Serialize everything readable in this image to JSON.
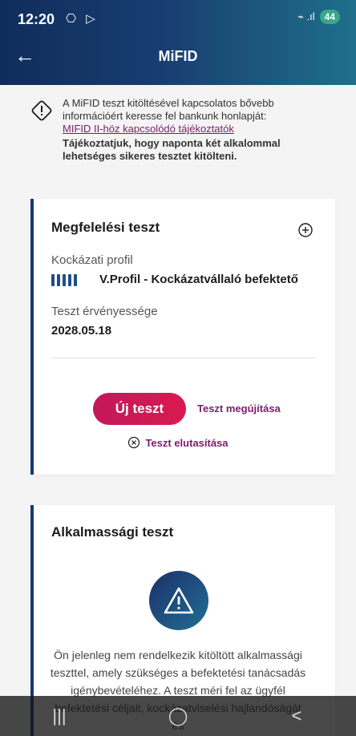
{
  "status_bar": {
    "time": "12:20",
    "icons_left": "⎔ ▷",
    "network": "⌁ .ıl",
    "battery": "44"
  },
  "header": {
    "title": "MiFID"
  },
  "info": {
    "line1": "A MiFID teszt kitöltésével kapcsolatos bővebb információért keresse fel bankunk honlapját:",
    "link": "MIFID II-höz kapcsolódó tájékoztatók",
    "notice": "Tájékoztatjuk, hogy naponta két alkalommal lehetséges sikeres tesztet kitölteni."
  },
  "compliance_card": {
    "title": "Megfelelési teszt",
    "risk_label": "Kockázati profil",
    "risk_value": "V.Profil - Kockázatvállaló befektető",
    "risk_level": 5,
    "validity_label": "Teszt érvényessége",
    "validity_value": "2028.05.18",
    "new_test_button": "Új teszt",
    "renew_link": "Teszt megújítása",
    "reject_link": "Teszt elutasítása"
  },
  "suitability_card": {
    "title": "Alkalmassági teszt",
    "message": "Ön jelenleg nem rendelkezik kitöltött alkalmassági teszttel, amely szükséges a befektetési tanácsadás igénybevételéhez. A teszt méri fel az ügyfél befektetési céljait, kockázatviselési hajlandóságát és"
  },
  "system_nav": {
    "recent": "|||",
    "home": "◯",
    "back": "<"
  },
  "colors": {
    "accent": "#c2185b",
    "primary": "#163a72",
    "link": "#7a1e6b"
  },
  "icons": [
    "back-arrow-icon",
    "info-diamond-icon",
    "plus-circle-icon",
    "risk-bars-icon",
    "close-circle-icon",
    "warning-triangle-icon"
  ]
}
